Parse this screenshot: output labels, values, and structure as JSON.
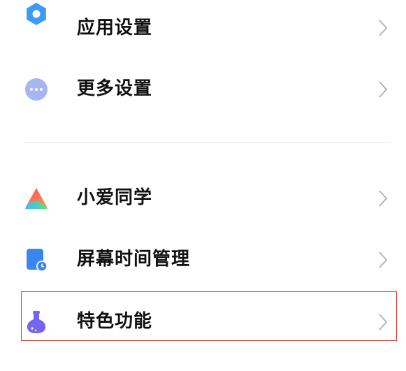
{
  "settings": {
    "items": [
      {
        "label": "应用设置",
        "icon": "gear-icon",
        "color": "#3b9cf2"
      },
      {
        "label": "更多设置",
        "icon": "more-dots-icon",
        "color": "#9fb2f0"
      },
      {
        "label": "小爱同学",
        "icon": "xiaoai-icon",
        "color": "#ff5c8a"
      },
      {
        "label": "屏幕时间管理",
        "icon": "screen-time-icon",
        "color": "#3a86f0"
      },
      {
        "label": "特色功能",
        "icon": "flask-icon",
        "color": "#7466f0"
      }
    ]
  },
  "highlight_color": "#e23b30"
}
